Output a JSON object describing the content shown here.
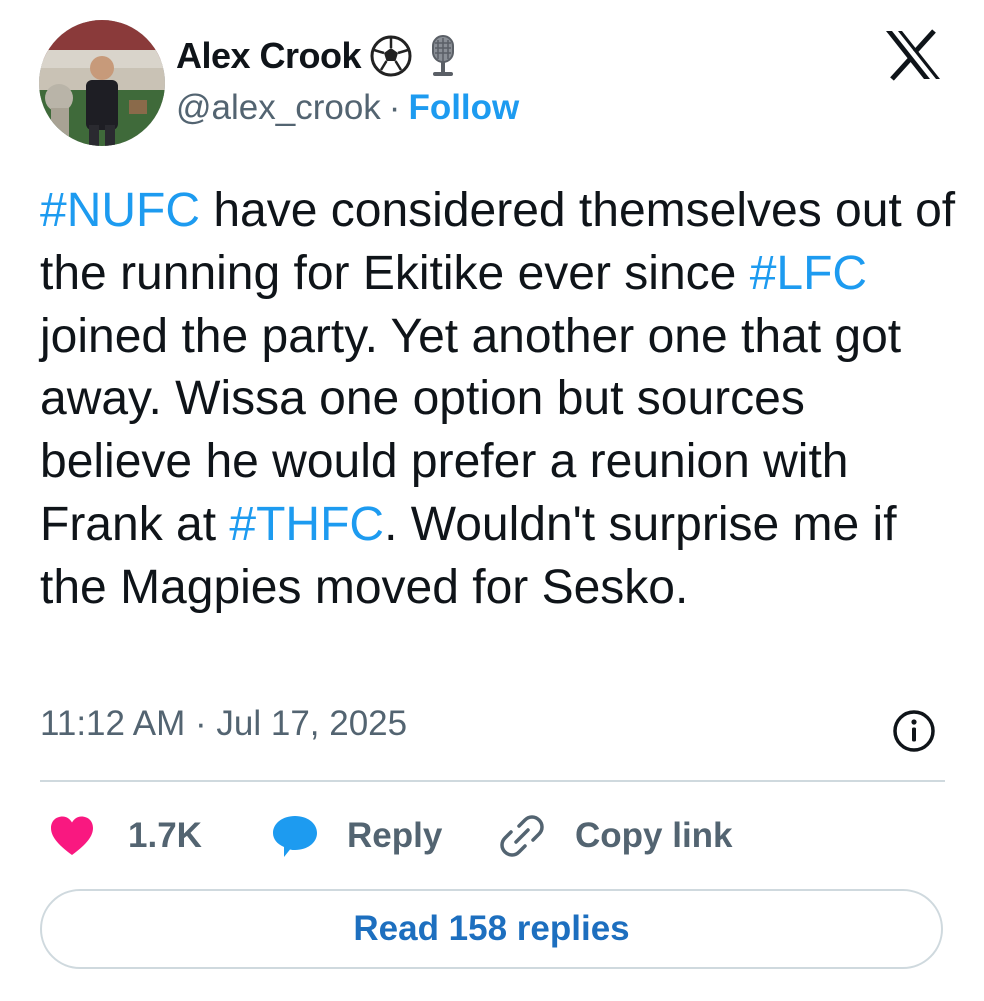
{
  "author": {
    "name": "Alex Crook",
    "handle": "@alex_crook",
    "separator": "·",
    "follow_label": "Follow",
    "emoji_icons": [
      "soccer-ball-icon",
      "microphone-icon"
    ]
  },
  "tweet": {
    "segments": [
      {
        "text": "#NUFC",
        "hashtag": true
      },
      {
        "text": " have considered themselves out of the running for Ekitike ever since ",
        "hashtag": false
      },
      {
        "text": "#LFC",
        "hashtag": true
      },
      {
        "text": " joined the party. Yet another one that got away. Wissa one option but sources believe he would prefer a reunion with Frank at ",
        "hashtag": false
      },
      {
        "text": "#THFC",
        "hashtag": true
      },
      {
        "text": ". Wouldn't surprise me if the Magpies moved for Sesko.",
        "hashtag": false
      }
    ],
    "timestamp": "11:12 AM · Jul 17, 2025"
  },
  "actions": {
    "like_count": "1.7K",
    "reply_label": "Reply",
    "copy_link_label": "Copy link"
  },
  "read_replies_label": "Read 158 replies",
  "colors": {
    "accent": "#1d9bf0",
    "like": "#f91880",
    "text": "#0f1419",
    "secondary": "#536471",
    "border": "#cfd9de"
  }
}
